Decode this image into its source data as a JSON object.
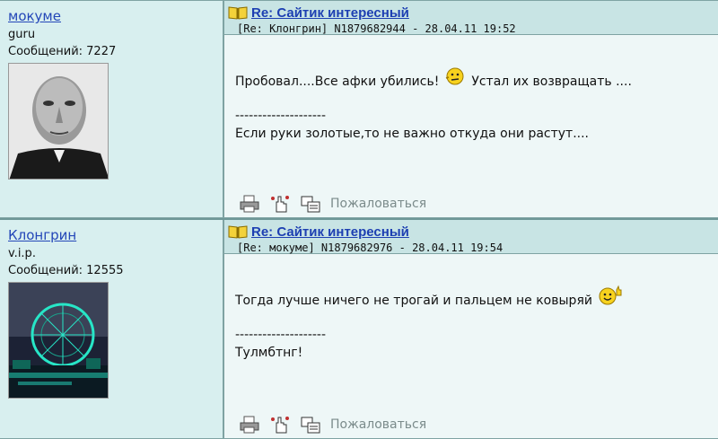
{
  "posts": [
    {
      "author": {
        "name": "мокуме",
        "rank": "guru",
        "messages": "Сообщений: 7227",
        "avatar_icon": "avatar-portrait"
      },
      "title": "Re: Сайтик интересный",
      "meta": "[Re: Клонгрин]  N1879682944 - 28.04.11 19:52",
      "body": {
        "line1_before": "Пробовал....Все афки убились!",
        "smiley_icon": "shrug-smiley-icon",
        "line1_after": "Устал их возвращать ....",
        "separator": "--------------------",
        "signature": "Если руки золотые,то не важно откуда они растут...."
      },
      "complain_label": "Пожаловаться"
    },
    {
      "author": {
        "name": "Клонгрин",
        "rank": "v.i.p.",
        "messages": "Сообщений: 12555",
        "avatar_icon": "avatar-ferris-wheel"
      },
      "title": "Re: Сайтик интересный",
      "meta": "[Re: мокуме]  N1879682976 - 28.04.11 19:54",
      "body": {
        "line1_before": "Тогда лучше ничего не трогай и пальцем не ковыряй",
        "smiley_icon": "thumbs-up-smiley-icon",
        "line1_after": "",
        "separator": "--------------------",
        "signature": "Тулмбтнг!"
      },
      "complain_label": "Пожаловаться"
    }
  ],
  "colors": {
    "author_bg": "#d8efef",
    "header_bg": "#c8e4e4",
    "body_bg": "#eef7f7",
    "link": "#1d3fb2",
    "border": "#7fa3a3"
  }
}
